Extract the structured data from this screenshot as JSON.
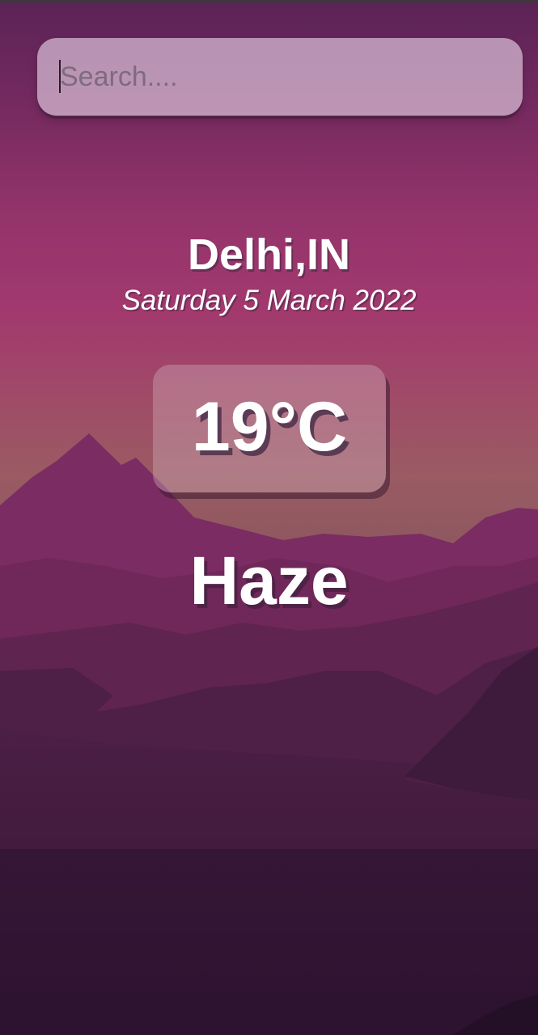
{
  "search": {
    "placeholder": "Search....",
    "value": ""
  },
  "location": {
    "city_country": "Delhi,IN"
  },
  "date": {
    "text": "Saturday 5 March 2022"
  },
  "weather": {
    "temperature": "19°C",
    "condition": "Haze"
  },
  "colors": {
    "sky_top": "#5e2557",
    "sky_mid": "#a2396e",
    "horizon": "#9a6362",
    "mountain_far": "#7e2d62",
    "mountain_near": "#4e2048",
    "ground_bottom": "#2f1530",
    "text": "#ffffff"
  },
  "background": {
    "icon": "mountain-landscape"
  }
}
